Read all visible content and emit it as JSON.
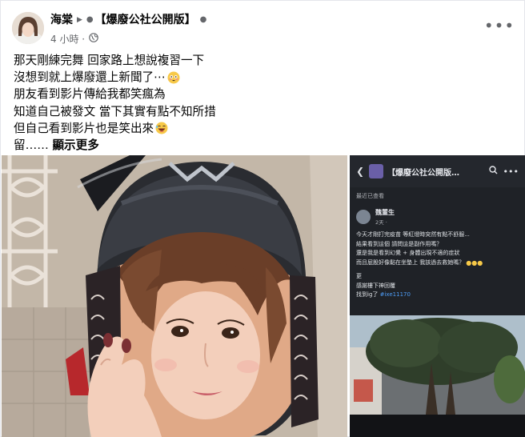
{
  "post": {
    "author": "海棠",
    "group": "【爆廢公社公開版】",
    "timestamp": "4 小時",
    "audience_icon": "globe-icon",
    "more_icon": "more-options-icon",
    "lines": [
      "那天剛練完舞 回家路上想說複習一下",
      "沒想到就上爆廢還上新聞了⋯",
      "朋友看到影片傳給我都笑瘋為",
      "知道自己被發文 當下其實有點不知所措",
      "但自己看到影片也是笑出來"
    ],
    "last_line_prefix": "留…… ",
    "see_more": "顯示更多",
    "emoji_colors": {
      "flushed": "#f7c948",
      "laugh": "#f7c948"
    }
  },
  "screenshot": {
    "group_title": "【爆廢公社公開版…",
    "recent_label": "最近已查看",
    "author": "魏董生",
    "time": "2天 ·",
    "body_lines": [
      "今天才剛打完疫苗 等紅燈時突然有點不舒服...",
      "結果看到這個 請問這是副作用嗎？",
      "還是我是看到幻覺 + 身體出現不適的症狀",
      "而且屁股好像黏在坐墊上 我該過去救她嗎？"
    ],
    "more_label": "更",
    "extra_lines": [
      "感謝樓下神回覆",
      "找到ig了"
    ],
    "tag": "#ixe11170"
  },
  "colors": {
    "secondary_text": "#65676b",
    "link_blue": "#4d9cf5"
  }
}
